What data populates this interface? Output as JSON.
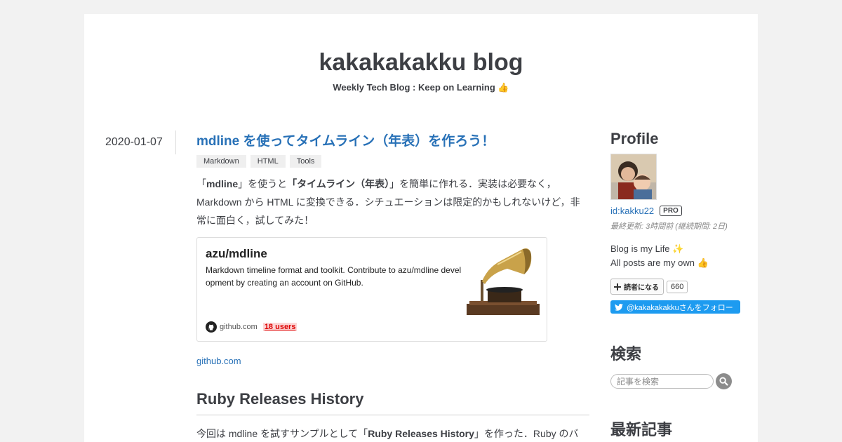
{
  "blog": {
    "title": "kakakakakku blog",
    "description": "Weekly Tech Blog : Keep on Learning 👍"
  },
  "entry": {
    "date": "2020-01-07",
    "title": "mdline を使ってタイムライン（年表）を作ろう！",
    "tags": [
      "Markdown",
      "HTML",
      "Tools"
    ],
    "lead": {
      "q1_open": "「",
      "q1_bold": "mdline",
      "q1_close": "」を使うと",
      "q2_open": "「",
      "q2_bold": "タイムライン（年表）",
      "q2_close": "」を簡単に作れる．実装は必要なく，Markdown から HTML に変換できる．シチュエーションは限定的かもしれないけど，非常に面白く，試してみた！"
    },
    "card": {
      "title": "azu/mdline",
      "description": "Markdown timeline format and toolkit. Contribute to azu/mdline development by creating an account on GitHub.",
      "domain": "github.com",
      "users": "18 users"
    },
    "source_link": "github.com",
    "section_heading": "Ruby Releases History",
    "section_para": {
      "pre": "今回は mdline を試すサンプルとして「",
      "bold": "Ruby Releases History",
      "post": "」を作った．Ruby のバ"
    }
  },
  "sidebar": {
    "profile_heading": "Profile",
    "user_id": "id:kakku22",
    "pro_badge": "PRO",
    "last_updated": "最終更新: 3時間前 (継続期間: 2日)",
    "bio_line1": "Blog is my Life ✨",
    "bio_line2": "All posts are my own 👍",
    "reader_button": "読者になる",
    "reader_count": "660",
    "twitter_button": "@kakakakakkuさんをフォロー",
    "search_heading": "検索",
    "search_placeholder": "記事を検索",
    "latest_heading": "最新記事"
  },
  "colors": {
    "link": "#2871b7",
    "text": "#3d3f44",
    "twitter": "#1d9bf0",
    "users_badge": "#d00000"
  }
}
